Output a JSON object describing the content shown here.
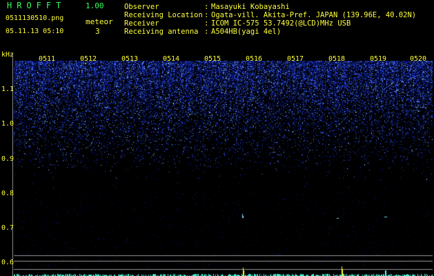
{
  "header": {
    "app_title": "HROFFT",
    "app_version": "1.00",
    "file_name": "0511130510.png",
    "datetime": "05.11.13 05:10",
    "meteor_label": "meteor",
    "meteor_count": "3"
  },
  "info": [
    {
      "label": "Observer",
      "value": "Masayuki Kobayashi"
    },
    {
      "label": "Receiving Location",
      "value": "Ogata-vill. Akita-Pref. JAPAN (139.96E, 40.02N)"
    },
    {
      "label": "Receiver",
      "value": "ICOM IC-575 53.7492(@LCD)MHz USB"
    },
    {
      "label": "Receiving antenna",
      "value": "A504HB(yagi 4el)"
    }
  ],
  "spectrogram": {
    "y_unit": "kHz",
    "y_ticks": [
      "1.1",
      "1.0",
      "0.9",
      "0.8",
      "0.7",
      "0.6"
    ],
    "x_ticks": [
      "0511",
      "0512",
      "0513",
      "0514",
      "0515",
      "0516",
      "0517",
      "0518",
      "0519",
      "0520"
    ],
    "colors": {
      "noise_bright": "#3f6dff",
      "noise_dim": "#0a1a80",
      "meteor": "#ffff30",
      "trace": "#40ffe0",
      "reference_line": "#9a9a9a"
    }
  }
}
